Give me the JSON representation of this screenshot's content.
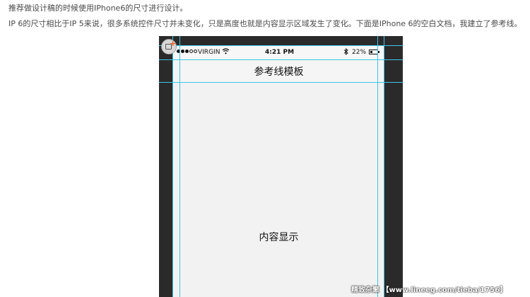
{
  "article": {
    "line1": "推荐做设计稿的时候使用IPhone6的尺寸进行设计。",
    "line2": "IP 6的尺寸相比于IP 5来说，很多系统控件尺寸并未变化，只是高度也就是内容显示区域发生了变化。下面是IPhone 6的空白文档，我建立了参考线。"
  },
  "status_bar": {
    "carrier": "VIRGIN",
    "time": "4:21 PM",
    "battery_percent": "22%",
    "signal_icon": "signal-dots-icon",
    "wifi_icon": "wifi-icon",
    "bluetooth_icon": "bluetooth-icon",
    "battery_icon": "battery-icon"
  },
  "screen": {
    "nav_title": "参考线模板",
    "content_label": "内容显示"
  },
  "overlay_icon": "add-frame-icon",
  "watermark": "精致杂聚 【www.lineeg.com/tieba/1756】",
  "colors": {
    "guide": "#3ec6e6",
    "frame": "#2a2a2a",
    "screen": "#f2f2f2",
    "accent": "#f05a16"
  }
}
